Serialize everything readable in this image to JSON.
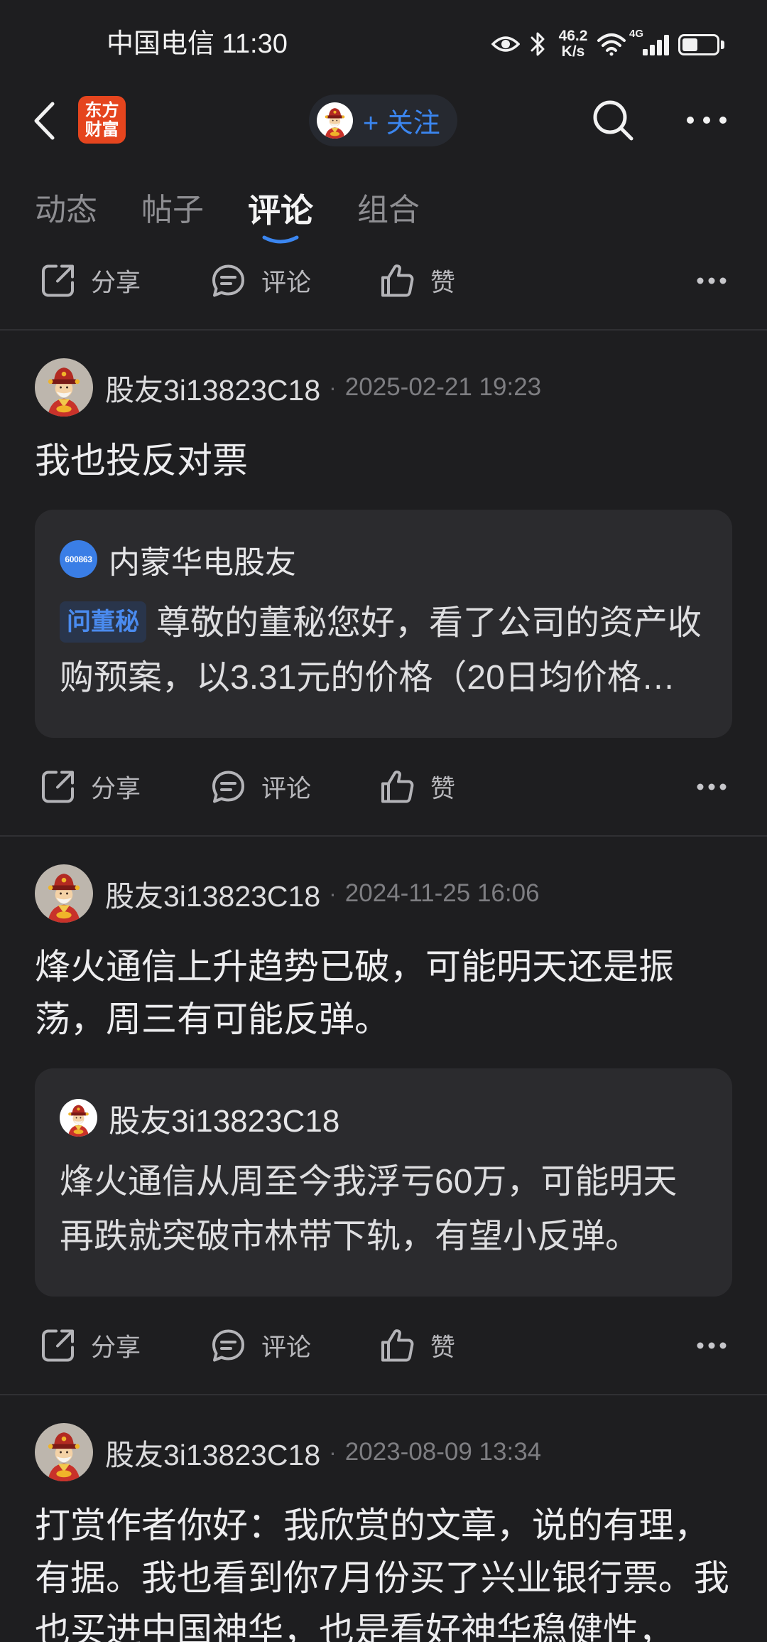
{
  "status_bar": {
    "carrier_time": "中国电信 11:30",
    "net_speed": "46.2",
    "net_speed_unit": "K/s",
    "network_type": "4G",
    "battery_level": 0.45
  },
  "header": {
    "logo_line1": "东方",
    "logo_line2": "财富",
    "follow_label": "+ 关注",
    "icons": [
      "back-arrow-icon",
      "search-icon",
      "more-icon"
    ]
  },
  "tabs": [
    {
      "label": "动态",
      "active": false
    },
    {
      "label": "帖子",
      "active": false
    },
    {
      "label": "评论",
      "active": true
    },
    {
      "label": "组合",
      "active": false
    }
  ],
  "actions": {
    "share": "分享",
    "comment": "评论",
    "like": "赞",
    "icons": [
      "share-icon",
      "comment-icon",
      "like-icon",
      "more-options-icon"
    ]
  },
  "meta_separator": "·",
  "posts": [
    {
      "username": "股友3i13823C18",
      "time": "2025-02-21 19:23",
      "content": "我也投反对票",
      "quote": {
        "badge": "600863",
        "author": "内蒙华电股友",
        "tag": "问董秘",
        "text": "尊敬的董秘您好，看了公司的资产收购预案，以3.31元的价格（20日均价格…"
      }
    },
    {
      "username": "股友3i13823C18",
      "time": "2024-11-25 16:06",
      "content": "烽火通信上升趋势已破，可能明天还是振荡，周三有可能反弹。",
      "quote": {
        "author": "股友3i13823C18",
        "text": "烽火通信从周至今我浮亏60万，可能明天再跌就突破市林带下轨，有望小反弹。"
      }
    },
    {
      "username": "股友3i13823C18",
      "time": "2023-08-09 13:34",
      "content": "打赏作者你好：我欣赏的文章，说的有理，有据。我也看到你7月份买了兴业银行票。我也买进中国神华，也是看好神华稳健性，"
    }
  ],
  "colors": {
    "accent": "#3b86f0",
    "background": "#1e1e20",
    "card": "#2b2b2e",
    "logo": "#e5451e"
  }
}
